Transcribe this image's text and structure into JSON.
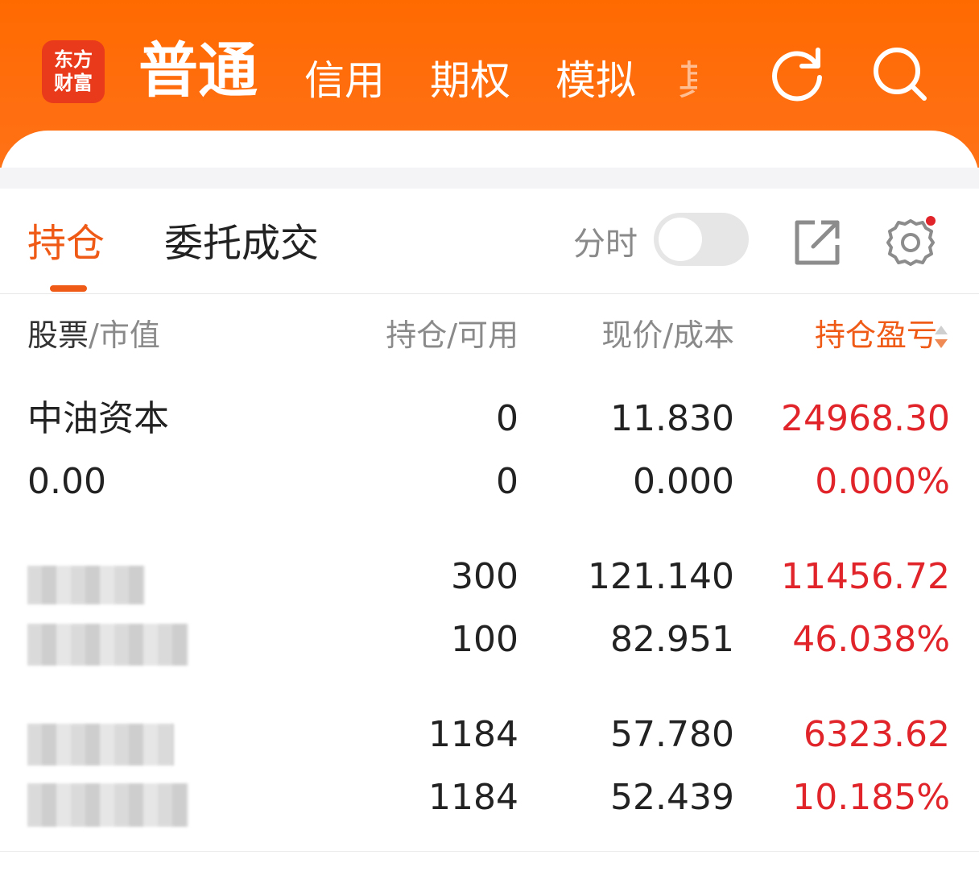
{
  "app": {
    "logo_line1": "东方",
    "logo_line2": "财富",
    "top_tabs": [
      "普通",
      "信用",
      "期权",
      "模拟",
      "其"
    ],
    "active_top_tab": "普通"
  },
  "colors": {
    "brand": "#ff6a00",
    "accent": "#ef5a16",
    "profit_red": "#e0242a"
  },
  "icons": {
    "refresh": "refresh-icon",
    "search": "search-icon",
    "share": "external-link-icon",
    "settings": "gear-icon"
  },
  "subtabs": {
    "items": [
      "持仓",
      "委托成交"
    ],
    "active": "持仓",
    "fenshi_label": "分时",
    "fenshi_on": false
  },
  "columns": {
    "stock": "股票",
    "mkt_value": "/市值",
    "holding": "持仓/可用",
    "price": "现价/成本",
    "pl": "持仓盈亏"
  },
  "rows": [
    {
      "name": "中油资本",
      "market_value": "0.00",
      "holding": "0",
      "available": "0",
      "price": "11.830",
      "cost": "0.000",
      "pl": "24968.30",
      "pl_pct": "0.000%",
      "name_obscured": false
    },
    {
      "name": "",
      "market_value": "",
      "holding": "300",
      "available": "100",
      "price": "121.140",
      "cost": "82.951",
      "pl": "11456.72",
      "pl_pct": "46.038%",
      "name_obscured": true
    },
    {
      "name": "",
      "market_value": "",
      "holding": "1184",
      "available": "1184",
      "price": "57.780",
      "cost": "52.439",
      "pl": "6323.62",
      "pl_pct": "10.185%",
      "name_obscured": true
    }
  ]
}
